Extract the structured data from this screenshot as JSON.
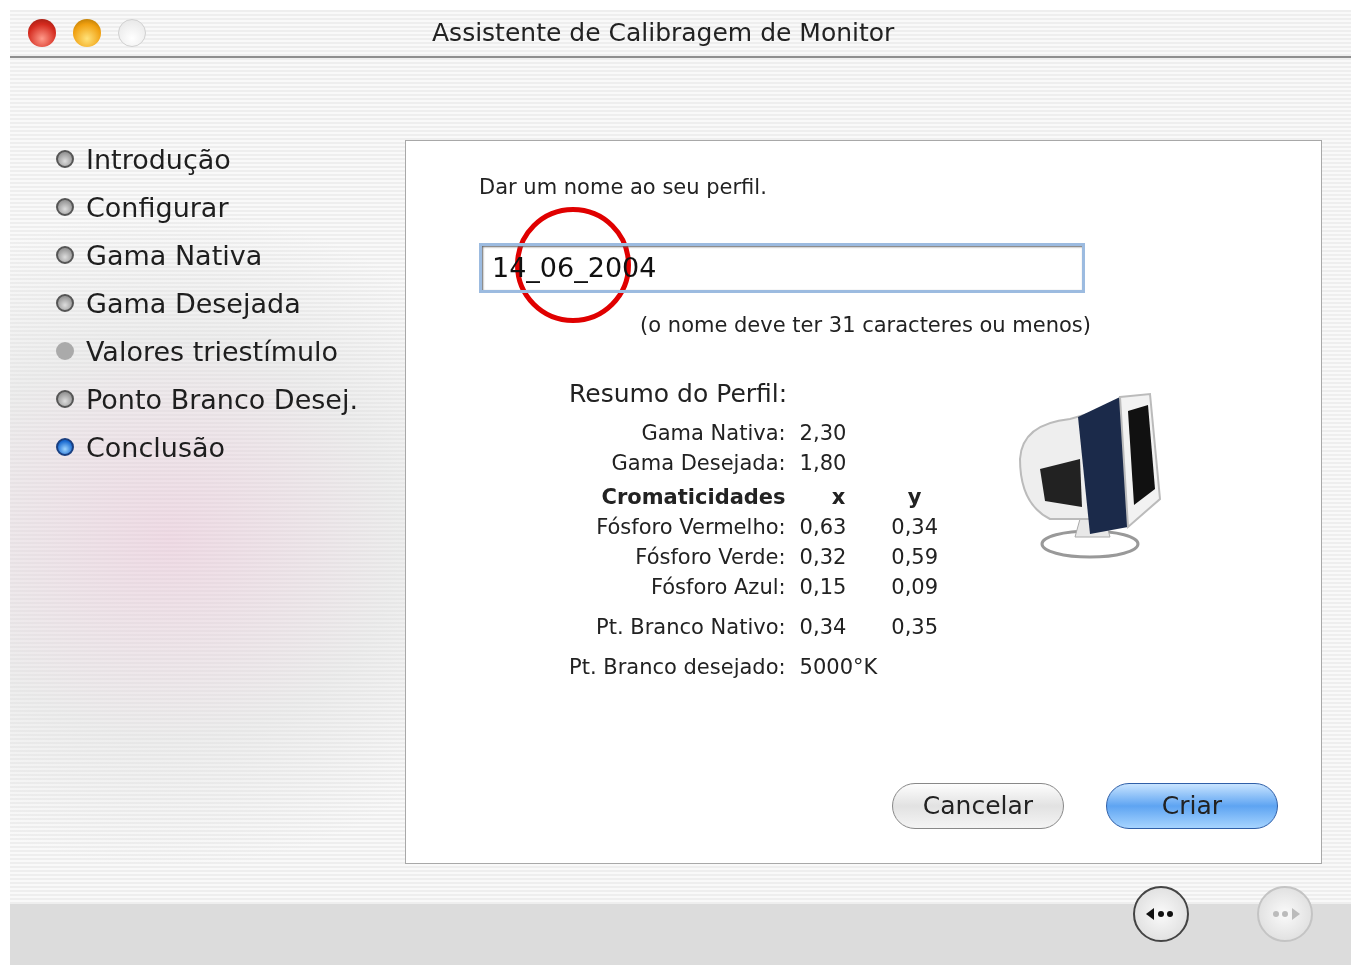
{
  "window": {
    "title": "Assistente de Calibragem de Monitor"
  },
  "steps": [
    {
      "label": "Introdução",
      "selected": false,
      "skipped": false
    },
    {
      "label": "Configurar",
      "selected": false,
      "skipped": false
    },
    {
      "label": "Gama Nativa",
      "selected": false,
      "skipped": false
    },
    {
      "label": "Gama Desejada",
      "selected": false,
      "skipped": false
    },
    {
      "label": "Valores triestímulo",
      "selected": false,
      "skipped": true
    },
    {
      "label": "Ponto Branco Desej.",
      "selected": false,
      "skipped": false
    },
    {
      "label": "Conclusão",
      "selected": true,
      "skipped": false
    }
  ],
  "prompt": "Dar um nome ao seu perfil.",
  "name_field": {
    "value": "14_06_2004"
  },
  "hint": "(o nome deve ter 31 caracteres ou menos)",
  "summary": {
    "title": "Resumo do Perfil:",
    "groups": [
      [
        {
          "kind": "row",
          "cells": [
            "Gama Nativa:",
            "2,30"
          ]
        },
        {
          "kind": "row",
          "cells": [
            "Gama Desejada:",
            "1,80"
          ]
        },
        {
          "kind": "header",
          "cells": [
            "Cromaticidades",
            "x",
            "y"
          ]
        },
        {
          "kind": "row",
          "cells": [
            "Fósforo Vermelho:",
            "0,63",
            "0,34"
          ]
        },
        {
          "kind": "row",
          "cells": [
            "Fósforo Verde:",
            "0,32",
            "0,59"
          ]
        },
        {
          "kind": "row",
          "cells": [
            "Fósforo Azul:",
            "0,15",
            "0,09"
          ]
        }
      ],
      [
        {
          "kind": "row",
          "cells": [
            "Pt. Branco Nativo:",
            "0,34",
            "0,35"
          ]
        }
      ],
      [
        {
          "kind": "row",
          "cells": [
            "Pt. Branco desejado:",
            "5000°K"
          ]
        }
      ]
    ]
  },
  "buttons": [
    {
      "label": "Cancelar",
      "default": false
    },
    {
      "label": "Criar",
      "default": true
    }
  ],
  "nav": [
    {
      "kind": "back",
      "disabled": false
    },
    {
      "kind": "forward",
      "disabled": true
    }
  ],
  "annotation": {
    "kind": "circle"
  }
}
